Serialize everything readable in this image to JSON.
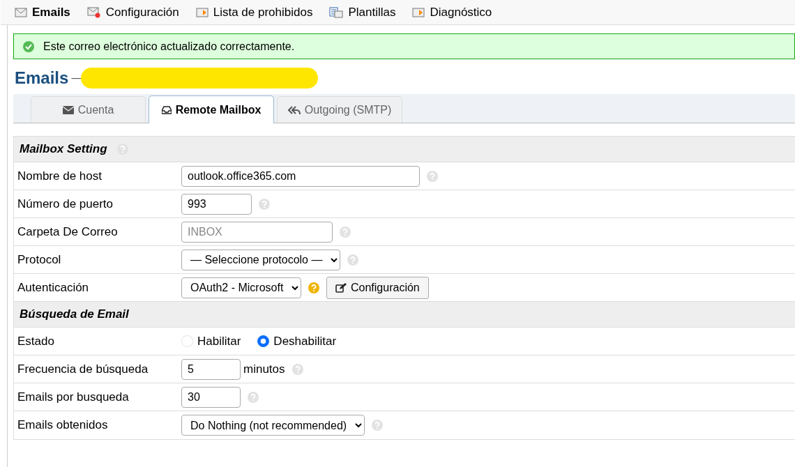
{
  "nav": [
    {
      "label": "Emails",
      "selected": true
    },
    {
      "label": "Configuración",
      "selected": false
    },
    {
      "label": "Lista de prohibidos",
      "selected": false
    },
    {
      "label": "Plantillas",
      "selected": false
    },
    {
      "label": "Diagnóstico",
      "selected": false
    }
  ],
  "alert": {
    "text": "Este correo electrónico actualizado correctamente."
  },
  "heading": {
    "title": "Emails",
    "separator": "—",
    "redacted": true
  },
  "tabs": [
    {
      "label": "Cuenta",
      "selected": false
    },
    {
      "label": "Remote Mailbox",
      "selected": true
    },
    {
      "label": "Outgoing (SMTP)",
      "selected": false
    }
  ],
  "sections": [
    {
      "title": "Mailbox Setting",
      "help": true,
      "rows": [
        {
          "kind": "text",
          "label": "Nombre de host",
          "value": "outlook.office365.com",
          "help": true,
          "help_highlighted": false
        },
        {
          "kind": "text",
          "label": "Número de puerto",
          "value": "993",
          "help": true,
          "help_highlighted": false
        },
        {
          "kind": "text",
          "label": "Carpeta De Correo",
          "placeholder": "INBOX",
          "help": true,
          "help_highlighted": false
        },
        {
          "kind": "select",
          "label": "Protocol",
          "value": "— Seleccione protocolo —",
          "help": true,
          "help_highlighted": false
        },
        {
          "kind": "select",
          "label": "Autenticación",
          "value": "OAuth2 - Microsoft",
          "help": true,
          "help_highlighted": true,
          "button": "Configuración"
        }
      ]
    },
    {
      "title": "Búsqueda de Email",
      "help": false,
      "rows": [
        {
          "kind": "radio",
          "label": "Estado",
          "help": false,
          "options": [
            {
              "label": "Habilitar",
              "selected": false
            },
            {
              "label": "Deshabilitar",
              "selected": true
            }
          ]
        },
        {
          "kind": "text",
          "label": "Frecuencia de búsqueda",
          "value": "5",
          "suffix": "minutos",
          "help": true,
          "help_highlighted": false
        },
        {
          "kind": "text",
          "label": "Emails por busqueda",
          "value": "30",
          "help": true,
          "help_highlighted": false
        },
        {
          "kind": "select",
          "label": "Emails obtenidos",
          "value": "Do Nothing (not recommended)",
          "help": true,
          "help_highlighted": false
        }
      ]
    }
  ]
}
